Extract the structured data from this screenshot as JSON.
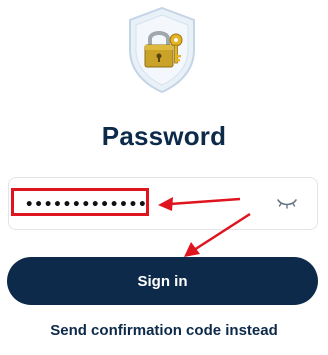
{
  "header": {
    "title": "Password",
    "icon": "shield-lock-key-icon"
  },
  "password_field": {
    "value": "•••••••••••••",
    "toggle_icon": "eye-closed-icon"
  },
  "annotation": {
    "color": "#e0141e"
  },
  "actions": {
    "signin_label": "Sign in",
    "alt_link_label": "Send confirmation code instead"
  },
  "colors": {
    "primary": "#0d2a4a",
    "border": "#e1e5ea"
  }
}
